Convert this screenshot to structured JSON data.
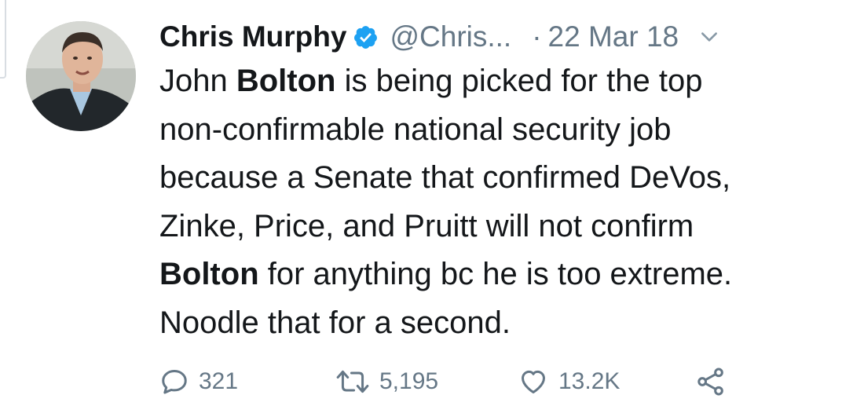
{
  "tweet": {
    "author": {
      "name": "Chris Murphy",
      "handle": "@Chris...",
      "verified": true
    },
    "separator": "·",
    "date": "22 Mar 18",
    "body_lines": [
      [
        {
          "text": "John ",
          "bold": false
        },
        {
          "text": "Bolton",
          "bold": true
        },
        {
          "text": " is being picked for the top",
          "bold": false
        }
      ],
      [
        {
          "text": "non-confirmable national security job",
          "bold": false
        }
      ],
      [
        {
          "text": "because a Senate that confirmed DeVos,",
          "bold": false
        }
      ],
      [
        {
          "text": "Zinke, Price, and Pruitt will not confirm",
          "bold": false
        }
      ],
      [
        {
          "text": "Bolton",
          "bold": true
        },
        {
          "text": " for anything bc he is too extreme.",
          "bold": false
        }
      ],
      [
        {
          "text": "Noodle that for a second.",
          "bold": false
        }
      ]
    ],
    "actions": {
      "replies": "321",
      "retweets": "5,195",
      "likes": "13.2K"
    },
    "icons": {
      "verified": "verified-badge-icon",
      "menu": "chevron-down-icon",
      "reply": "reply-bubble-icon",
      "retweet": "retweet-icon",
      "like": "heart-icon",
      "share": "share-icon"
    },
    "colors": {
      "verified_badge": "#1da1f2",
      "secondary_text": "#657786",
      "primary_text": "#14171a"
    }
  }
}
